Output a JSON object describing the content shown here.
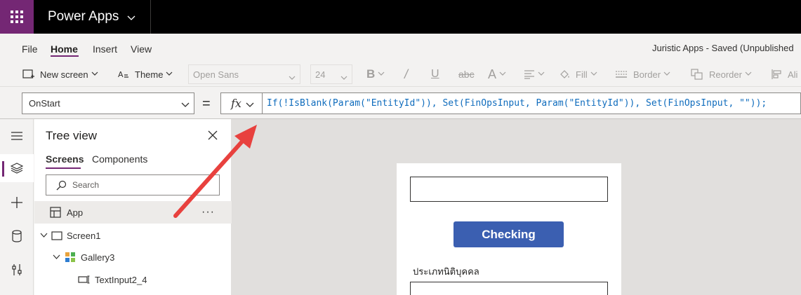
{
  "app_bar": {
    "app_name": "Power Apps"
  },
  "menu": {
    "items": [
      "File",
      "Home",
      "Insert",
      "View"
    ],
    "active": "Home",
    "saved_status": "Juristic Apps - Saved (Unpublished"
  },
  "toolbar": {
    "new_screen": "New screen",
    "theme": "Theme",
    "font_family": "Open Sans",
    "font_size": "24",
    "fill": "Fill",
    "border": "Border",
    "reorder": "Reorder",
    "align": "Ali"
  },
  "formula_bar": {
    "property": "OnStart",
    "equals": "=",
    "fx": "fx",
    "formula": "If(!IsBlank(Param(\"EntityId\")), Set(FinOpsInput, Param(\"EntityId\")), Set(FinOpsInput, \"\"));"
  },
  "tree_view": {
    "title": "Tree view",
    "tabs": [
      "Screens",
      "Components"
    ],
    "active_tab": "Screens",
    "search_placeholder": "Search",
    "items": [
      {
        "label": "App",
        "level": 0,
        "icon": "app-icon",
        "selected": true
      },
      {
        "label": "Screen1",
        "level": 0,
        "icon": "screen-icon"
      },
      {
        "label": "Gallery3",
        "level": 1,
        "icon": "gallery-icon"
      },
      {
        "label": "TextInput2_4",
        "level": 2,
        "icon": "text-input-icon"
      }
    ],
    "more_label": "···"
  },
  "canvas": {
    "button_label": "Checking",
    "entity_label": "ประเภทนิติบุคคล"
  },
  "colors": {
    "brand": "#742774",
    "button": "#3b5fb1",
    "arrow": "#e8413e"
  }
}
